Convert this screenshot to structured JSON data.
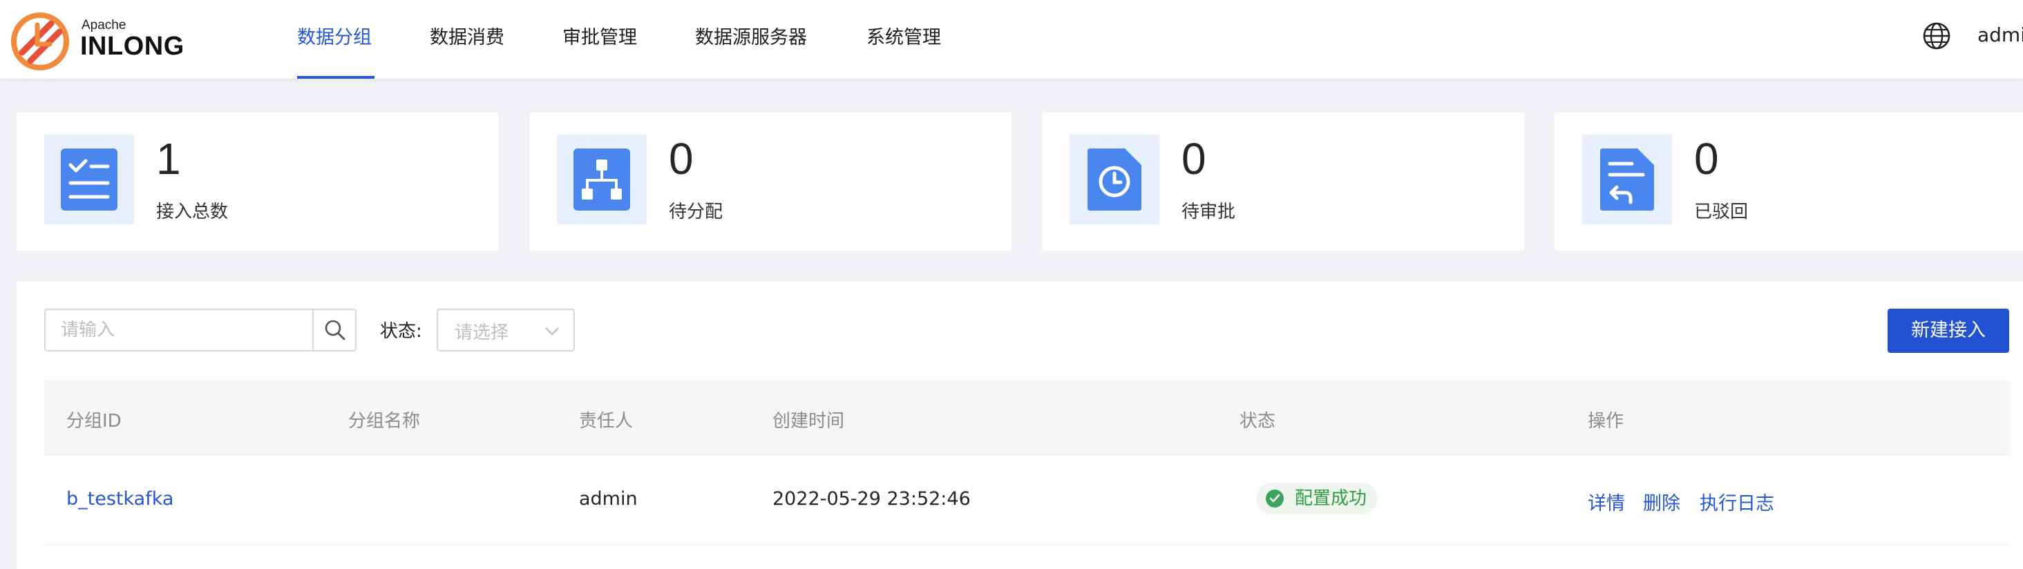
{
  "header": {
    "logo": {
      "apache": "Apache",
      "name": "INLONG",
      "icon": "inlong-logo-icon"
    },
    "nav": [
      {
        "label": "数据分组",
        "active": true
      },
      {
        "label": "数据消费",
        "active": false
      },
      {
        "label": "审批管理",
        "active": false
      },
      {
        "label": "数据源服务器",
        "active": false
      },
      {
        "label": "系统管理",
        "active": false
      }
    ],
    "language_icon": "globe-icon",
    "user": "admi"
  },
  "stats": [
    {
      "value": "1",
      "label": "接入总数",
      "icon": "checklist-icon"
    },
    {
      "value": "0",
      "label": "待分配",
      "icon": "hierarchy-icon"
    },
    {
      "value": "0",
      "label": "待审批",
      "icon": "clock-document-icon"
    },
    {
      "value": "0",
      "label": "已驳回",
      "icon": "return-document-icon"
    }
  ],
  "filters": {
    "search_placeholder": "请输入",
    "search_icon": "search-icon",
    "status_label": "状态:",
    "status_placeholder": "请选择",
    "new_button": "新建接入"
  },
  "table": {
    "columns": [
      "分组ID",
      "分组名称",
      "责任人",
      "创建时间",
      "状态",
      "操作"
    ],
    "rows": [
      {
        "group_id": "b_testkafka",
        "group_name": "",
        "owner": "admin",
        "created": "2022-05-29 23:52:46",
        "status": "配置成功",
        "actions": [
          "详情",
          "删除",
          "执行日志"
        ]
      }
    ]
  },
  "colors": {
    "primary": "#2656d9",
    "button": "#2252d1",
    "icon": "#4a86f0",
    "icon_bg": "#e8f0fd",
    "success": "#3ba55c"
  }
}
